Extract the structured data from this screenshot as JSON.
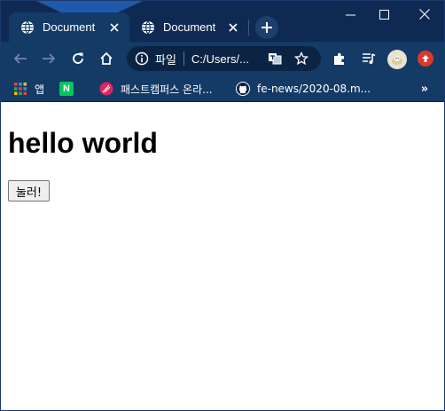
{
  "browser": {
    "tabs": [
      {
        "title": "Document",
        "active": true
      },
      {
        "title": "Document",
        "active": false
      }
    ],
    "address": {
      "scheme_label": "파일",
      "url": "C:/Users/..."
    },
    "bookmarks": [
      {
        "label": "앱",
        "icon": "apps-grid-icon"
      },
      {
        "label": "",
        "icon": "naver-icon",
        "icon_text": "N"
      },
      {
        "label": "패스트캠퍼스 온라...",
        "icon": "fastcampus-icon"
      },
      {
        "label": "fe-news/2020-08.m...",
        "icon": "github-icon"
      }
    ],
    "bookmarks_overflow": "»"
  },
  "page": {
    "heading": "hello world",
    "button_label": "눌러!"
  },
  "colors": {
    "tabstrip": "#0f2a52",
    "toolbar": "#143a66",
    "omnibox": "#0c2444",
    "update_badge": "#d93a2b",
    "naver_green": "#03c75a",
    "fastcampus_red": "#e0245e"
  }
}
